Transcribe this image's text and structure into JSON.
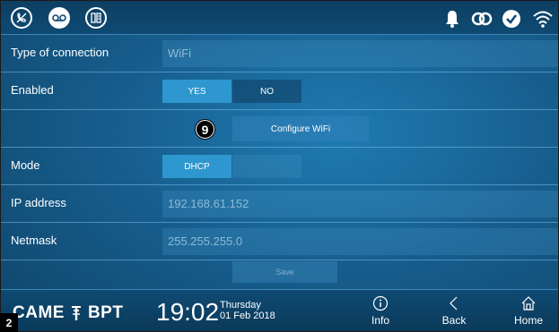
{
  "header": {
    "left_icons": [
      "no-call-icon",
      "answering-machine-icon",
      "intercom-icon"
    ],
    "status_icons": [
      "bell-icon",
      "link-icon",
      "check-circle-icon",
      "wifi-icon"
    ]
  },
  "form": {
    "connection_type": {
      "label": "Type of connection",
      "value": "WiFi"
    },
    "enabled": {
      "label": "Enabled",
      "yes": "YES",
      "no": "NO",
      "selected": "YES"
    },
    "configure": {
      "badge": "9",
      "button": "Configure WiFi"
    },
    "mode": {
      "label": "Mode",
      "value": "DHCP"
    },
    "ip": {
      "label": "IP address",
      "value": "192.168.61.152"
    },
    "netmask": {
      "label": "Netmask",
      "value": "255.255.255.0"
    },
    "save_label": "Save"
  },
  "footer": {
    "brand_left": "CAME",
    "brand_right": "BPT",
    "time": "19:02",
    "weekday": "Thursday",
    "date": "01 Feb 2018",
    "nav": [
      {
        "label": "Info",
        "icon": "info-icon"
      },
      {
        "label": "Back",
        "icon": "back-icon"
      },
      {
        "label": "Home",
        "icon": "home-icon"
      }
    ]
  },
  "figure_number": "2",
  "colors": {
    "accent": "#2e97cf",
    "background": "#175f8f",
    "bar": "#0e4a73"
  }
}
